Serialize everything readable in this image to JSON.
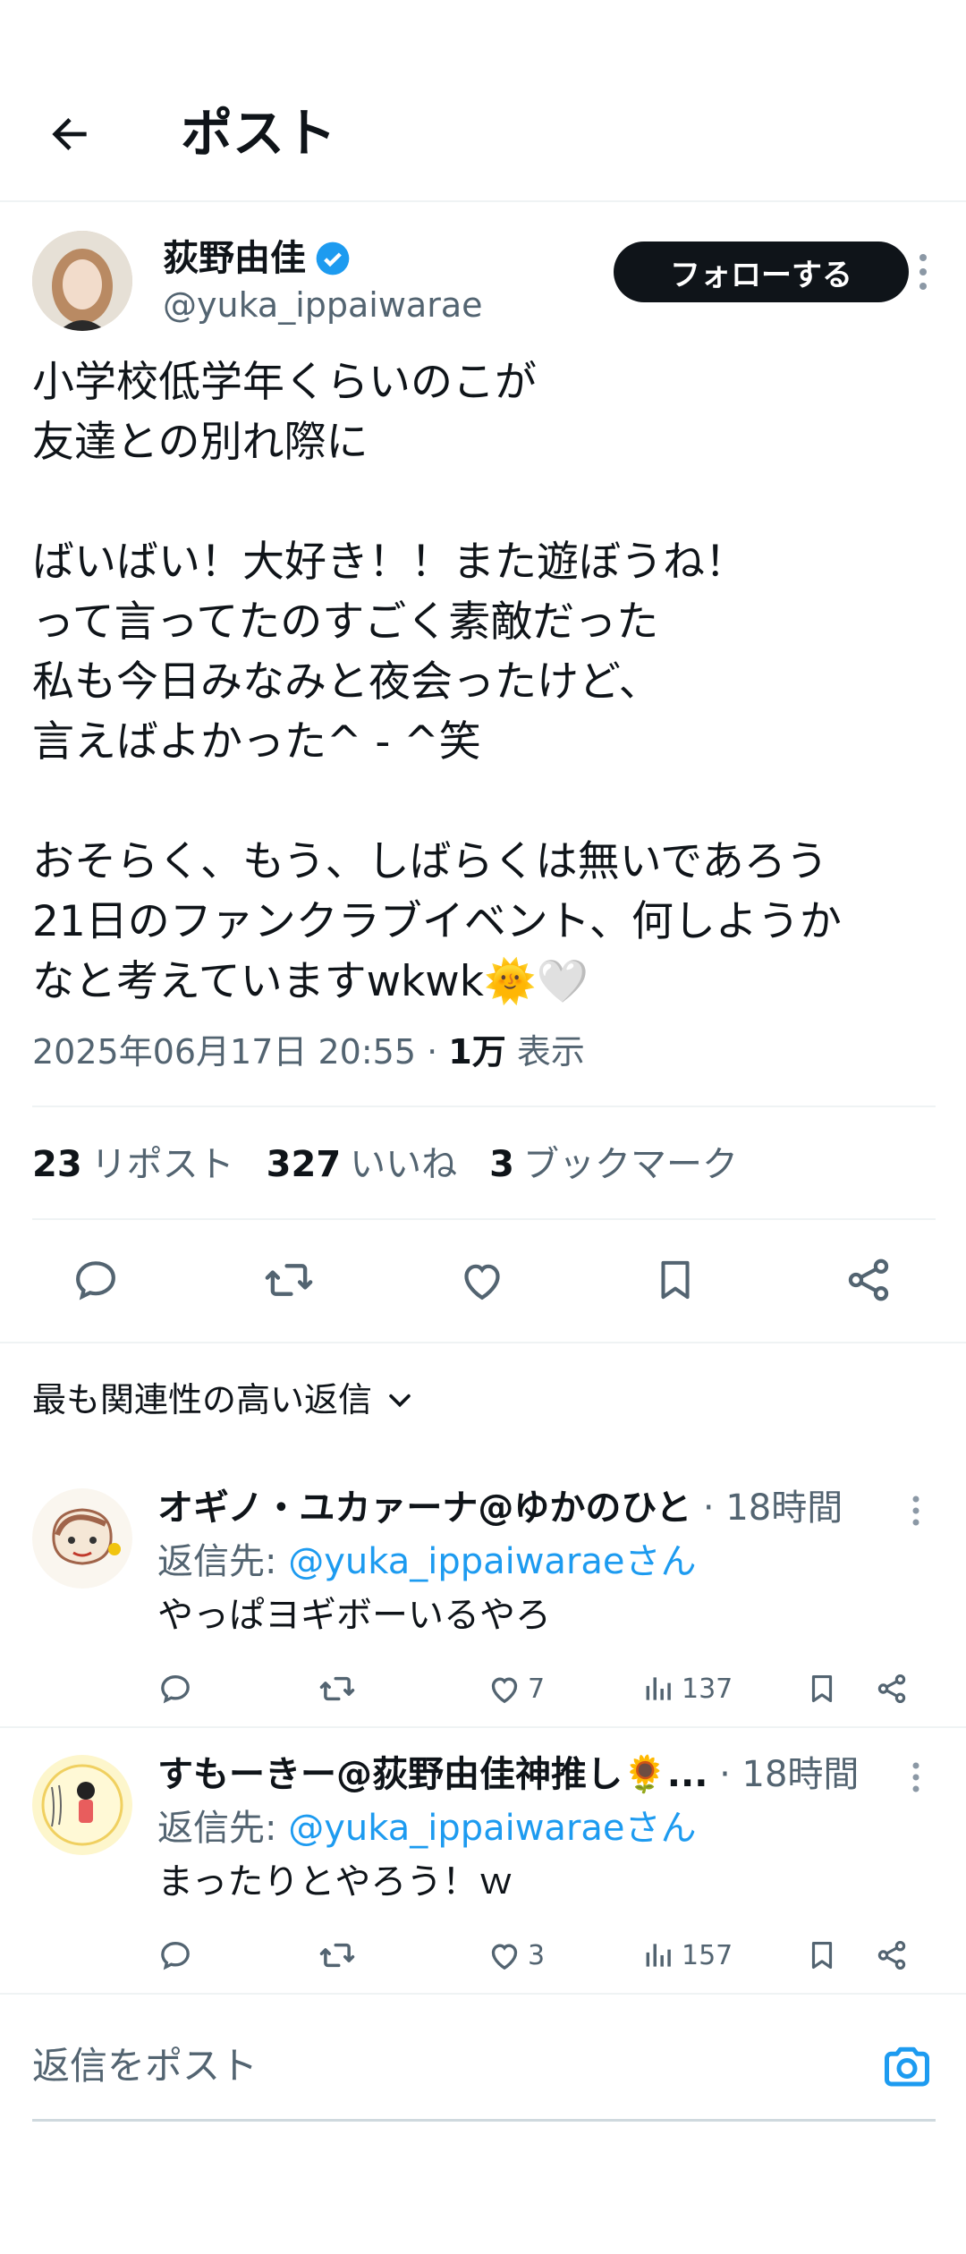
{
  "appbar": {
    "title": "ポスト",
    "back_icon": "arrow-left-icon"
  },
  "author": {
    "display_name": "荻野由佳",
    "handle": "@yuka_ippaiwarae",
    "verified_icon": "verified-badge-icon",
    "follow_label": "フォローする",
    "more_icon": "more-vertical-icon"
  },
  "post": {
    "text": "小学校低学年くらいのこが\n友達との別れ際に\n\nばいばい！大好き！！また遊ぼうね！\nって言ってたのすごく素敵だった\n私も今日みなみと夜会ったけど、\n言えばよかった^ - ^笑\n\nおそらく、もう、しばらくは無いであろう\n21日のファンクラブイベント、何しようか\nなと考えていますwkwk🌞🤍",
    "datetime": "2025年06月17日 20:55",
    "views_count": "1万",
    "views_label": "表示"
  },
  "stats": [
    {
      "count": "23",
      "label": "リポスト"
    },
    {
      "count": "327",
      "label": "いいね"
    },
    {
      "count": "3",
      "label": "ブックマーク"
    }
  ],
  "actions": [
    "reply-icon",
    "repost-icon",
    "like-icon",
    "bookmark-icon",
    "share-icon"
  ],
  "sort_label": "最も関連性の高い返信",
  "replies": [
    {
      "name": "オギノ・ユカァーナ@ゆかのひと",
      "time": " · 18時間",
      "reply_to_prefix": "返信先: ",
      "reply_to_handle": "@yuka_ippaiwarae",
      "reply_to_suffix": "さん",
      "text": "やっぱヨギボーいるやろ",
      "likes": "7",
      "views": "137"
    },
    {
      "name": "すもーきー@荻野由佳神推し🌻...",
      "time": " · 18時間",
      "reply_to_prefix": "返信先: ",
      "reply_to_handle": "@yuka_ippaiwarae",
      "reply_to_suffix": "さん",
      "text": "まったりとやろう！ｗ",
      "likes": "3",
      "views": "157"
    }
  ],
  "reply_bar": {
    "placeholder": "返信をポスト",
    "camera_icon": "camera-icon"
  },
  "colors": {
    "accent": "#1d9bf0",
    "text": "#0f1419",
    "secondary": "#536471",
    "divider": "#eff3f4"
  }
}
